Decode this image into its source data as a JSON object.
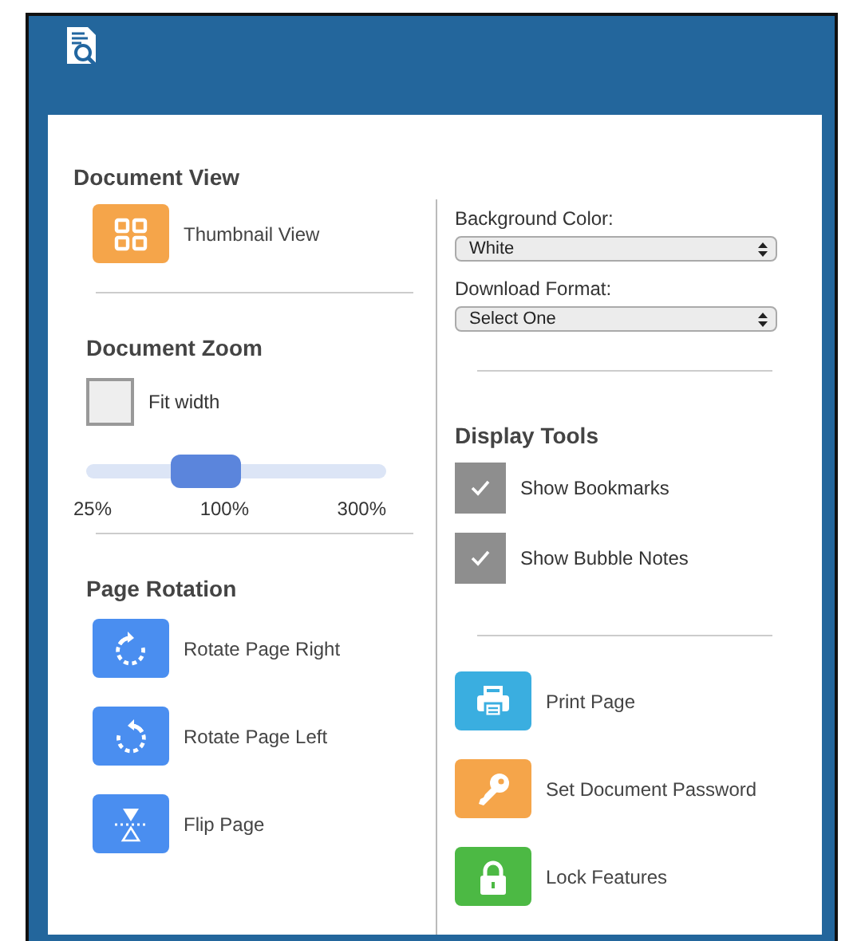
{
  "document_view": {
    "title": "Document View",
    "tools": [
      {
        "label": "Thumbnail View",
        "kind": "grid",
        "color": "#f5a54a"
      }
    ]
  },
  "document_zoom": {
    "title": "Document Zoom",
    "fit_width": {
      "label": "Fit width",
      "checked": false
    },
    "slider": {
      "level": 0.4,
      "ticks": [
        "25%",
        "100%",
        "300%"
      ]
    }
  },
  "page_rotation": {
    "title": "Page Rotation",
    "tools": [
      {
        "label": "Rotate Page Right",
        "kind": "rotate_right",
        "color": "#4a8ef0"
      },
      {
        "label": "Rotate Page Left",
        "kind": "rotate_left",
        "color": "#4a8ef0"
      },
      {
        "label": "Flip Page",
        "kind": "flip",
        "color": "#4a8ef0"
      }
    ]
  },
  "selects": [
    {
      "label": "Background Color:",
      "value": "White"
    },
    {
      "label": "Download Format:",
      "value": "Select One"
    }
  ],
  "display_tools": {
    "title": "Display Tools",
    "options": [
      {
        "label": "Show Bookmarks",
        "checked": true
      },
      {
        "label": "Show Bubble Notes",
        "checked": true
      }
    ]
  },
  "actions": [
    {
      "label": "Print Page",
      "kind": "printer",
      "color": "#3aaee0"
    },
    {
      "label": "Set Document Password",
      "kind": "key",
      "color": "#f5a54a"
    },
    {
      "label": "Lock Features",
      "kind": "lock",
      "color": "#4cb944"
    }
  ]
}
